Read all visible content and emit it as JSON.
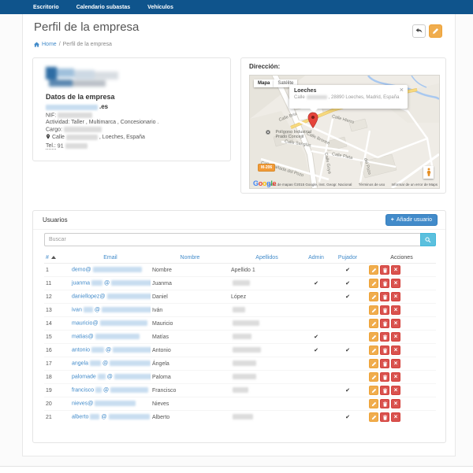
{
  "navbar": {
    "items": [
      {
        "label": "Escritorio"
      },
      {
        "label": "Calendario subastas"
      },
      {
        "label": "Vehículos"
      }
    ]
  },
  "page": {
    "title": "Perfil de la empresa",
    "breadcrumb": {
      "home_label": "Home",
      "separator": "/",
      "current": "Perfil de la empresa"
    }
  },
  "company": {
    "heading": "Datos de la empresa",
    "website_suffix": ".es",
    "nif_label": "NIF:",
    "activity_line": "Actividad: Taller , Multimarca , Concesionario .",
    "cargo_label": "Cargo:",
    "address_prefix": "Calle",
    "address_suffix": ", Loeches, España",
    "tel_label": "Tel.:",
    "tel_prefix": "91"
  },
  "map": {
    "heading": "Dirección:",
    "controls": {
      "map_label": "Mapa",
      "satellite_label": "Satélite"
    },
    "infowindow": {
      "title": "Loeches",
      "address_prefix": "Calle",
      "address_suffix": ", 28890 Loeches, Madrid, España",
      "close_glyph": "×"
    },
    "streets": {
      "bria": "Calle Bria",
      "hierro": "Calle Hierro",
      "bronce": "Calle Bronce",
      "sanglas": "Calle Sanglas",
      "plata": "Calle Plata",
      "canada": "Calle Cañada del Pozo",
      "goya": "Calle Goya",
      "pozo": "del Pozo",
      "poligono_line1": "Polígono Industrial",
      "poligono_line2": "Prado Concejil"
    },
    "road_badge": "M-206",
    "google_logo": "Google",
    "attribution": {
      "data": "Datos de mapas ©2015 Google, Inst. Geogr. Nacional",
      "terms": "Términos de uso",
      "report": "Informar de un error de Maps"
    }
  },
  "users": {
    "heading": "Usuarios",
    "add_button": {
      "icon": "+",
      "label": "Añadir usuario"
    },
    "search": {
      "placeholder": "Buscar"
    },
    "columns": [
      {
        "label": "#"
      },
      {
        "label": "Email"
      },
      {
        "label": "Nombre"
      },
      {
        "label": "Apellidos"
      },
      {
        "label": "Admin"
      },
      {
        "label": "Pujador"
      },
      {
        "label": "Acciones"
      }
    ],
    "rows": [
      {
        "num": "1",
        "email_visible": "demo@",
        "email_mid_redacted": false,
        "nombre": "Nombre",
        "apellidos": "Apellido 1",
        "apellidos_redacted": false,
        "admin": false,
        "pujador": true
      },
      {
        "num": "11",
        "email_visible": "juanma",
        "email_mid_redacted": true,
        "nombre": "Juanma",
        "apellidos": "",
        "apellidos_redacted": true,
        "admin": true,
        "pujador": true
      },
      {
        "num": "12",
        "email_visible": "daniellopez@",
        "email_mid_redacted": false,
        "nombre": "Daniel",
        "apellidos": "López",
        "apellidos_redacted": false,
        "admin": false,
        "pujador": true
      },
      {
        "num": "13",
        "email_visible": "ivan",
        "email_mid_redacted": true,
        "nombre": "Iván",
        "apellidos": "",
        "apellidos_redacted": true,
        "admin": false,
        "pujador": false
      },
      {
        "num": "14",
        "email_visible": "mauricio@",
        "email_mid_redacted": false,
        "nombre": "Mauricio",
        "apellidos": "",
        "apellidos_redacted": true,
        "admin": false,
        "pujador": false
      },
      {
        "num": "15",
        "email_visible": "matias@",
        "email_mid_redacted": false,
        "nombre": "Matías",
        "apellidos": "",
        "apellidos_redacted": true,
        "admin": true,
        "pujador": false
      },
      {
        "num": "16",
        "email_visible": "antonio",
        "email_mid_redacted": true,
        "nombre": "Antonio",
        "apellidos": "",
        "apellidos_redacted": true,
        "admin": true,
        "pujador": true
      },
      {
        "num": "17",
        "email_visible": "angela",
        "email_mid_redacted": true,
        "nombre": "Ángela",
        "apellidos": "",
        "apellidos_redacted": true,
        "admin": false,
        "pujador": false
      },
      {
        "num": "18",
        "email_visible": "palomade",
        "email_mid_redacted": true,
        "nombre": "Paloma",
        "apellidos": "",
        "apellidos_redacted": true,
        "admin": false,
        "pujador": false
      },
      {
        "num": "19",
        "email_visible": "francisco",
        "email_mid_redacted": true,
        "nombre": "Francisco",
        "apellidos": "",
        "apellidos_redacted": true,
        "admin": false,
        "pujador": true
      },
      {
        "num": "20",
        "email_visible": "nieves@",
        "email_mid_redacted": false,
        "nombre": "Nieves",
        "apellidos": "",
        "apellidos_redacted": false,
        "admin": false,
        "pujador": false
      },
      {
        "num": "21",
        "email_visible": "alberto",
        "email_mid_redacted": true,
        "nombre": "Alberto",
        "apellidos": "",
        "apellidos_redacted": true,
        "admin": false,
        "pujador": true
      }
    ]
  },
  "colors": {
    "navbar_bg": "#0f548c",
    "link_blue": "#428bca",
    "edit_orange": "#f0ad4e",
    "delete_red": "#d9534f",
    "search_btn_blue": "#5bc0de"
  }
}
